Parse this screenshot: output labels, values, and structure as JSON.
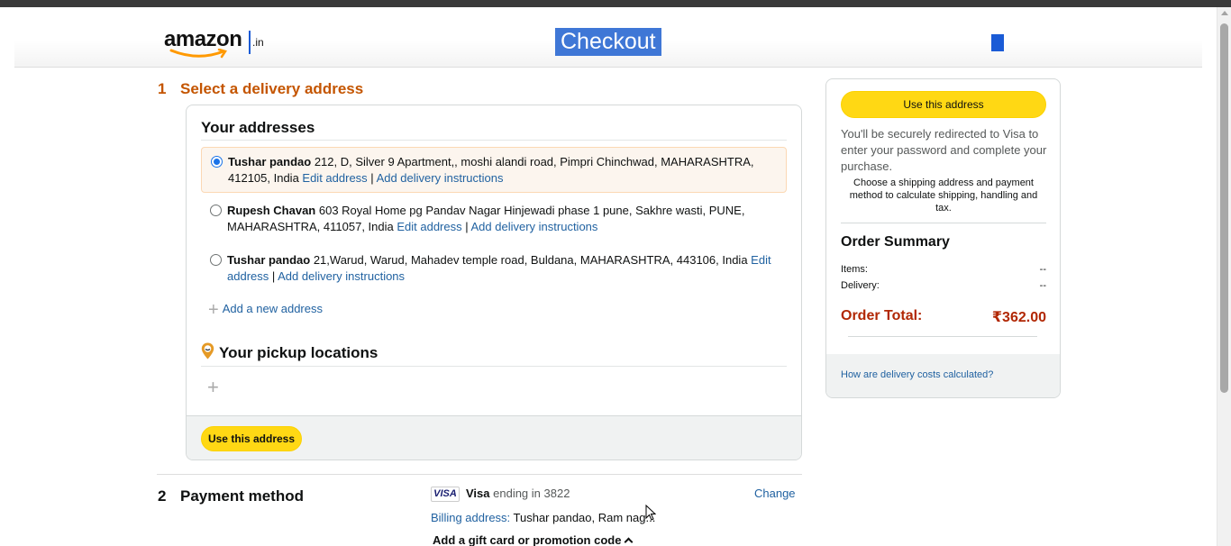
{
  "header": {
    "logo_word": "amazon",
    "logo_tld": ".in",
    "title": "Checkout"
  },
  "step1": {
    "number": "1",
    "title": "Select a delivery address",
    "addresses_heading": "Your addresses",
    "addresses": [
      {
        "name": "Tushar pandao",
        "address": " 212, D, Silver 9 Apartment,, moshi alandi road, Pimpri Chinchwad, MAHARASHTRA, 412105, India ",
        "edit_label": "Edit address",
        "separator": " | ",
        "instructions_label": "Add delivery instructions",
        "selected": true
      },
      {
        "name": "Rupesh Chavan",
        "address": " 603 Royal Home pg Pandav Nagar Hinjewadi phase 1 pune, Sakhre wasti, PUNE, MAHARASHTRA, 411057, India ",
        "edit_label": "Edit address",
        "separator": " | ",
        "instructions_label": "Add delivery instructions",
        "selected": false
      },
      {
        "name": "Tushar pandao",
        "address": " 21,Warud, Warud, Mahadev temple road, Buldana, MAHARASHTRA, 443106, India ",
        "edit_label": "Edit address",
        "separator": " | ",
        "instructions_label": "Add delivery instructions",
        "selected": false
      }
    ],
    "add_new_label": "Add a new address",
    "pickup_heading": "Your pickup locations",
    "use_address_button": "Use this address"
  },
  "step2": {
    "number": "2",
    "title": "Payment method",
    "card_brand_logo": "VISA",
    "card_brand": "Visa",
    "ending_label": " ending in ",
    "last_digits": "3822",
    "change_label": "Change",
    "billing_label": "Billing address:",
    "billing_value": " Tushar pandao, Ram nag...",
    "gift_label": "Add a gift card or promotion code"
  },
  "summary": {
    "use_address_button": "Use this address",
    "redirect_text": "You'll be securely redirected to Visa to enter your password and complete your purchase.",
    "choose_text": "Choose a shipping address and payment method to calculate shipping, handling and tax.",
    "title": "Order Summary",
    "items_label": "Items:",
    "items_value": "--",
    "delivery_label": "Delivery:",
    "delivery_value": "--",
    "total_label": "Order Total:",
    "total_value": "₹362.00",
    "delivery_costs_link": "How are delivery costs calculated?"
  },
  "colors": {
    "accent_orange": "#c45500",
    "button_yellow": "#ffd814",
    "link_blue": "#2162a1",
    "total_red": "#b12704"
  },
  "icons": {
    "logo_smile": "smile-arrow-icon",
    "lock": "lock-icon",
    "pickup": "location-pin-icon",
    "plus": "plus-icon",
    "caret": "chevron-up-icon",
    "cursor": "mouse-pointer-icon"
  }
}
